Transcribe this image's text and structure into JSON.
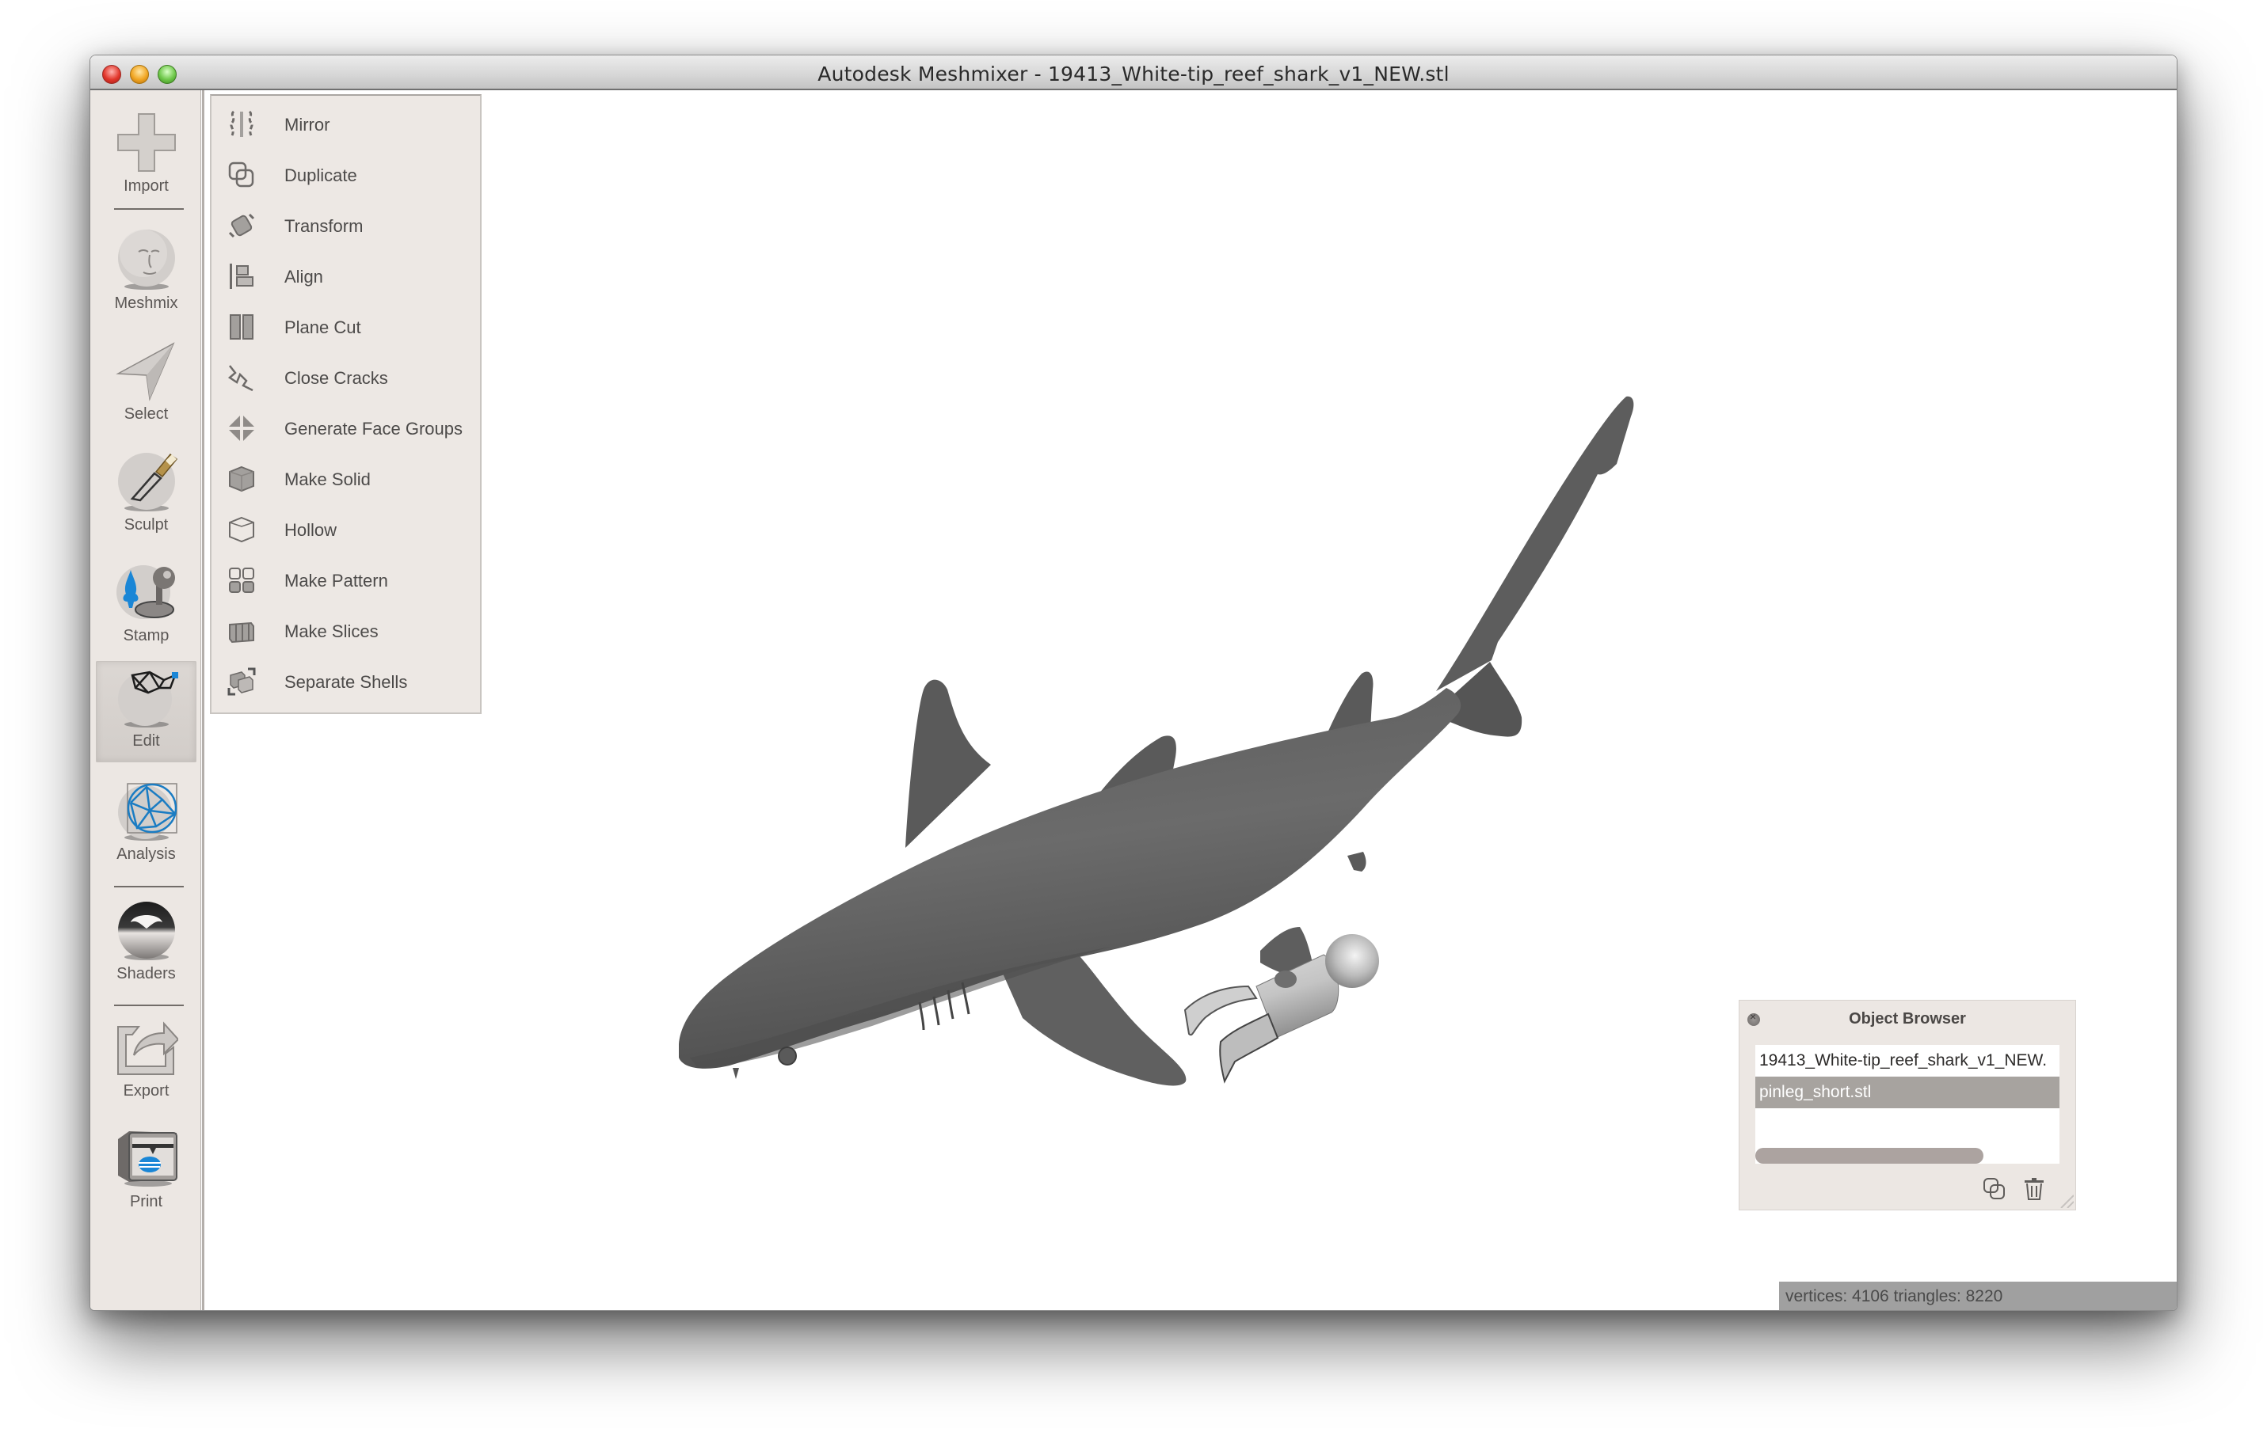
{
  "window": {
    "title": "Autodesk Meshmixer - 19413_White-tip_reef_shark_v1_NEW.stl",
    "controls": [
      "close",
      "minimize",
      "zoom"
    ]
  },
  "toolbar": {
    "items": [
      {
        "label": "Import",
        "icon": "plus-icon",
        "active": false
      },
      {
        "label": "Meshmix",
        "icon": "face-sphere-icon",
        "active": false
      },
      {
        "label": "Select",
        "icon": "arrow-pointer-icon",
        "active": false
      },
      {
        "label": "Sculpt",
        "icon": "brush-sphere-icon",
        "active": false
      },
      {
        "label": "Stamp",
        "icon": "stamp-icon",
        "active": false
      },
      {
        "label": "Edit",
        "icon": "mesh-edit-icon",
        "active": true
      },
      {
        "label": "Analysis",
        "icon": "analysis-mesh-icon",
        "active": false
      },
      {
        "label": "Shaders",
        "icon": "chrome-sphere-icon",
        "active": false
      },
      {
        "label": "Export",
        "icon": "export-arrow-icon",
        "active": false
      },
      {
        "label": "Print",
        "icon": "printer-3d-icon",
        "active": false
      }
    ]
  },
  "edit_menu": {
    "items": [
      {
        "label": "Mirror",
        "icon": "mirror-icon"
      },
      {
        "label": "Duplicate",
        "icon": "duplicate-icon"
      },
      {
        "label": "Transform",
        "icon": "transform-icon"
      },
      {
        "label": "Align",
        "icon": "align-icon"
      },
      {
        "label": "Plane Cut",
        "icon": "plane-cut-icon"
      },
      {
        "label": "Close Cracks",
        "icon": "close-cracks-icon"
      },
      {
        "label": "Generate Face Groups",
        "icon": "face-groups-icon"
      },
      {
        "label": "Make Solid",
        "icon": "solid-cube-icon"
      },
      {
        "label": "Hollow",
        "icon": "hollow-cube-icon"
      },
      {
        "label": "Make Pattern",
        "icon": "pattern-grid-icon"
      },
      {
        "label": "Make Slices",
        "icon": "slices-icon"
      },
      {
        "label": "Separate Shells",
        "icon": "separate-shells-icon"
      }
    ]
  },
  "viewport": {
    "objects": [
      {
        "name": "19413_White-tip_reef_shark_v1_NEW.stl",
        "color": "#606060"
      },
      {
        "name": "pinleg_short.stl",
        "color": "#c8c8c8"
      }
    ]
  },
  "object_browser": {
    "title": "Object Browser",
    "items": [
      {
        "label": "19413_White-tip_reef_shark_v1_NEW.",
        "selected": false
      },
      {
        "label": "pinleg_short.stl",
        "selected": true
      }
    ],
    "buttons": {
      "duplicate": "duplicate-icon",
      "delete": "trash-icon"
    }
  },
  "status": {
    "text": "vertices: 4106 triangles: 8220"
  },
  "colors": {
    "panel_bg": "#ece7e3",
    "selection": "#a7a39f",
    "accent_blue": "#1a86d6",
    "statusbar": "#a0a0a0"
  }
}
